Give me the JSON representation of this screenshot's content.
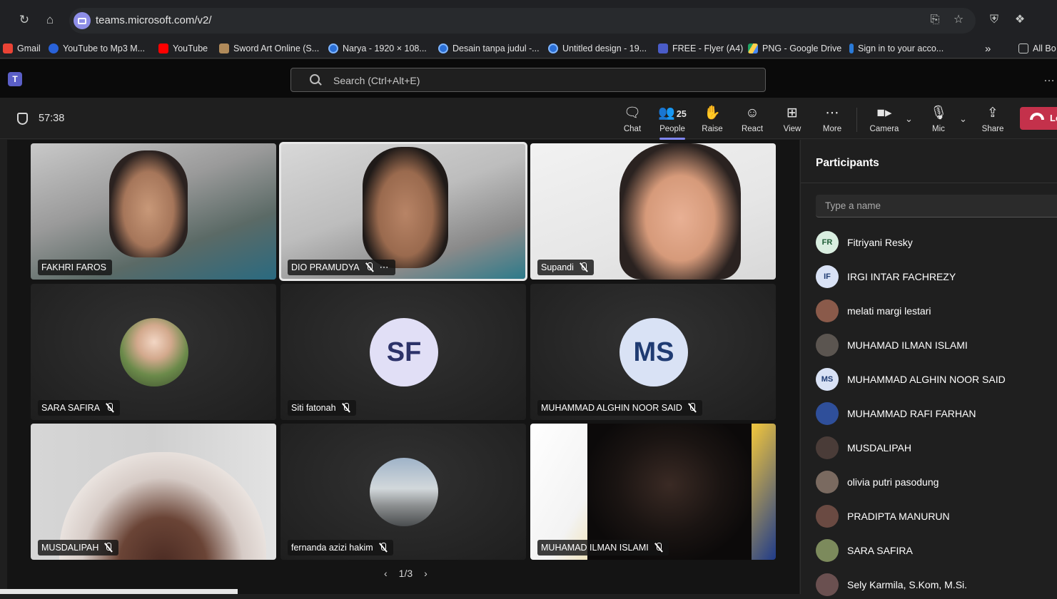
{
  "browser": {
    "url": "teams.microsoft.com/v2/",
    "bookmarks": [
      "Gmail",
      "YouTube to Mp3 M...",
      "YouTube",
      "Sword Art Online (S...",
      "Narya - 1920 × 108...",
      "Desain tanpa judul -...",
      "Untitled design - 19...",
      "FREE - Flyer (A4)",
      "PNG - Google Drive",
      "Sign in to your acco...",
      "All Bo"
    ]
  },
  "teams": {
    "search_placeholder": "Search (Ctrl+Alt+E)",
    "logo_letter": "T"
  },
  "meeting": {
    "timer": "57:38",
    "people_count": "25",
    "toolbar": {
      "chat": "Chat",
      "people": "People",
      "raise": "Raise",
      "react": "React",
      "view": "View",
      "more": "More",
      "camera": "Camera",
      "mic": "Mic",
      "share": "Share",
      "leave": "Le"
    }
  },
  "tiles": [
    {
      "name": "FAKHRI FAROS"
    },
    {
      "name": "DIO PRAMUDYA"
    },
    {
      "name": "Supandi"
    },
    {
      "name": "SARA SAFIRA"
    },
    {
      "name": "Siti fatonah",
      "initials": "SF"
    },
    {
      "name": "MUHAMMAD ALGHIN NOOR SAID",
      "initials": "MS"
    },
    {
      "name": "MUSDALIPAH"
    },
    {
      "name": "fernanda azizi hakim"
    },
    {
      "name": "MUHAMAD ILMAN ISLAMI"
    }
  ],
  "pager": "1/3",
  "panel": {
    "title": "Participants",
    "search_placeholder": "Type a name",
    "participants": [
      {
        "name": "Fitriyani Resky",
        "initials": "FR",
        "color": "#d9eee0",
        "text": "#1d5c35"
      },
      {
        "name": "IRGI INTAR FACHREZY",
        "initials": "IF",
        "color": "#d9e2f5",
        "text": "#1f3b72"
      },
      {
        "name": "melati margi lestari",
        "initials": "",
        "color": "#8a5a4a",
        "text": "#fff"
      },
      {
        "name": "MUHAMAD ILMAN ISLAMI",
        "initials": "",
        "color": "#5b5550",
        "text": "#fff"
      },
      {
        "name": "MUHAMMAD ALGHIN NOOR SAID",
        "initials": "MS",
        "color": "#d9e2f5",
        "text": "#1f3b72"
      },
      {
        "name": "MUHAMMAD RAFI FARHAN",
        "initials": "",
        "color": "#2f4f9a",
        "text": "#fff"
      },
      {
        "name": "MUSDALIPAH",
        "initials": "",
        "color": "#4a3c38",
        "text": "#fff"
      },
      {
        "name": "olivia putri pasodung",
        "initials": "",
        "color": "#7a6a60",
        "text": "#fff"
      },
      {
        "name": "PRADIPTA MANURUN",
        "initials": "",
        "color": "#6a4a42",
        "text": "#fff"
      },
      {
        "name": "SARA SAFIRA",
        "initials": "",
        "color": "#7c8a5c",
        "text": "#fff"
      },
      {
        "name": "Sely Karmila, S.Kom, M.Si.",
        "initials": "",
        "color": "#6a5050",
        "text": "#fff"
      }
    ]
  }
}
